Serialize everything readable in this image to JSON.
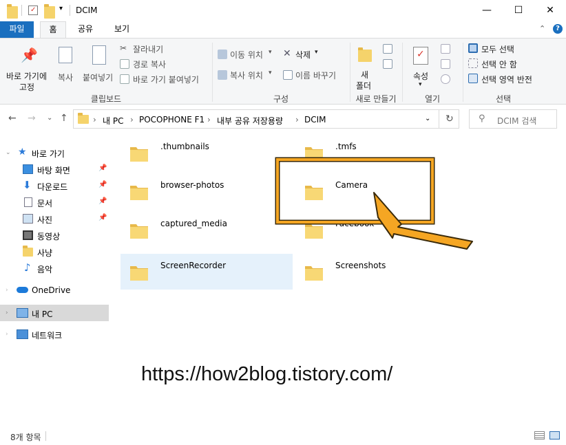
{
  "window": {
    "title": "DCIM",
    "minimize": "—",
    "maximize": "☐",
    "close": "✕"
  },
  "ribbon_tabs": [
    "파일",
    "홈",
    "공유",
    "보기"
  ],
  "ribbon": {
    "clipboard": {
      "pin_label_1": "바로 가기에",
      "pin_label_2": "고정",
      "copy": "복사",
      "paste": "붙여넣기",
      "cut": "잘라내기",
      "copy_path": "경로 복사",
      "paste_shortcut": "바로 가기 붙여넣기",
      "group": "클립보드"
    },
    "organize": {
      "move_to": "이동 위치",
      "copy_to": "복사 위치",
      "delete": "삭제",
      "rename": "이름 바꾸기",
      "group": "구성"
    },
    "new": {
      "new_folder_1": "새",
      "new_folder_2": "폴더",
      "group": "새로 만들기"
    },
    "open": {
      "properties": "속성",
      "group": "열기"
    },
    "select": {
      "select_all": "모두 선택",
      "select_none": "선택 안 함",
      "invert": "선택 영역 반전",
      "group": "선택"
    }
  },
  "breadcrumb": [
    "내 PC",
    "POCOPHONE F1",
    "내부 공유 저장용량",
    "DCIM"
  ],
  "search": {
    "placeholder": "DCIM 검색"
  },
  "sidebar": {
    "quick_access": "바로 가기",
    "items": [
      {
        "label": "바탕 화면",
        "icon": "desktop-icon",
        "pinned": true
      },
      {
        "label": "다운로드",
        "icon": "download-icon",
        "pinned": true
      },
      {
        "label": "문서",
        "icon": "document-icon",
        "pinned": true
      },
      {
        "label": "사진",
        "icon": "pictures-icon",
        "pinned": true
      },
      {
        "label": "동영상",
        "icon": "video-icon",
        "pinned": false
      },
      {
        "label": "사냥",
        "icon": "folder-icon",
        "pinned": false
      },
      {
        "label": "음악",
        "icon": "music-icon",
        "pinned": false
      }
    ],
    "onedrive": "OneDrive",
    "this_pc": "내 PC",
    "network": "네트워크"
  },
  "folders": [
    {
      "name": ".thumbnails"
    },
    {
      "name": ".tmfs"
    },
    {
      "name": "browser-photos"
    },
    {
      "name": "Camera"
    },
    {
      "name": "captured_media"
    },
    {
      "name": "Facebook"
    },
    {
      "name": "ScreenRecorder",
      "selected": true
    },
    {
      "name": "Screenshots"
    }
  ],
  "watermark": "https://how2blog.tistory.com/",
  "status": {
    "item_count": "8개 항목"
  },
  "colors": {
    "accent": "#1a6fbf",
    "folder": "#f5d36b",
    "annotation": "#f5a623"
  }
}
